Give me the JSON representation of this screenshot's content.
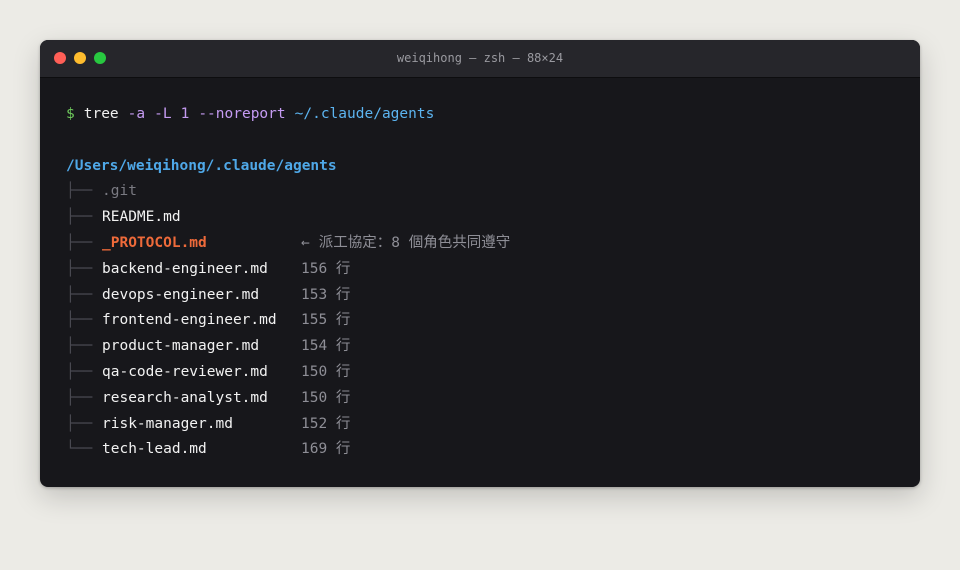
{
  "window": {
    "title": "weiqihong — zsh — 88×24"
  },
  "command": {
    "prompt": "$",
    "program": "tree",
    "flags": [
      "-a",
      "-L",
      "1",
      "--noreport"
    ],
    "path": "~/.claude/agents"
  },
  "output": {
    "root": "/Users/weiqihong/.claude/agents",
    "branch_mid": "├──",
    "branch_last": "└──",
    "entries": [
      {
        "name": ".git",
        "note": ""
      },
      {
        "name": "README.md",
        "note": ""
      },
      {
        "name": "_PROTOCOL.md",
        "note": "派工協定：8 個角色共同遵守"
      },
      {
        "name": "backend-engineer.md",
        "note": "156 行"
      },
      {
        "name": "devops-engineer.md",
        "note": "153 行"
      },
      {
        "name": "frontend-engineer.md",
        "note": "155 行"
      },
      {
        "name": "product-manager.md",
        "note": "154 行"
      },
      {
        "name": "qa-code-reviewer.md",
        "note": "150 行"
      },
      {
        "name": "research-analyst.md",
        "note": "150 行"
      },
      {
        "name": "risk-manager.md",
        "note": "152 行"
      },
      {
        "name": "tech-lead.md",
        "note": "169 行"
      }
    ]
  },
  "icons": {
    "note_arrow": "←"
  },
  "colors": {
    "highlight": "#ee6a3a",
    "directory": "#4fa8e8",
    "prompt": "#6ec85c",
    "flag": "#c59bf2"
  }
}
